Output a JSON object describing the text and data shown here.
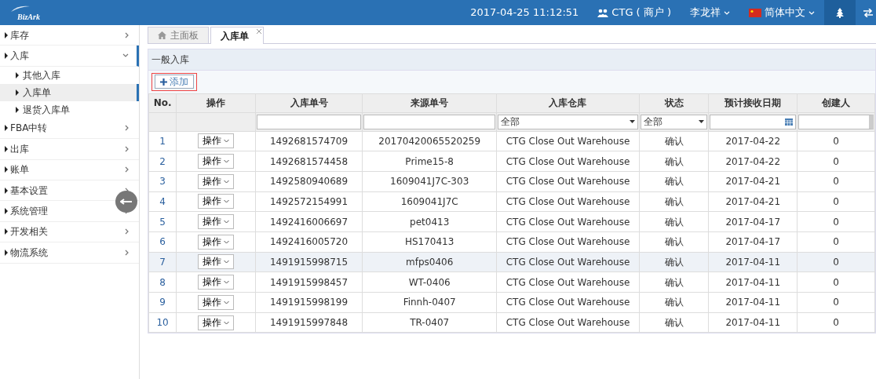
{
  "header": {
    "logo": "BizArk",
    "datetime": "2017-04-25 11:12:51",
    "merchant": "CTG ( 商户 )",
    "user": "李龙祥",
    "language": "简体中文"
  },
  "sidebar": {
    "items": [
      {
        "label": "库存",
        "expanded": false,
        "selected": false
      },
      {
        "label": "入库",
        "expanded": true,
        "selected": false,
        "children": [
          {
            "label": "其他入库",
            "selected": false
          },
          {
            "label": "入库单",
            "selected": true
          },
          {
            "label": "退货入库单",
            "selected": false
          }
        ]
      },
      {
        "label": "FBA中转",
        "expanded": false,
        "selected": false
      },
      {
        "label": "出库",
        "expanded": false,
        "selected": false
      },
      {
        "label": "账单",
        "expanded": false,
        "selected": false
      },
      {
        "label": "基本设置",
        "expanded": false,
        "selected": false
      },
      {
        "label": "系统管理",
        "expanded": false,
        "selected": false
      },
      {
        "label": "开发相关",
        "expanded": false,
        "selected": false
      },
      {
        "label": "物流系统",
        "expanded": false,
        "selected": false
      }
    ]
  },
  "tabs": [
    {
      "label": "主面板",
      "kind": "home",
      "selected": false
    },
    {
      "label": "入库单",
      "kind": "closable",
      "selected": true
    }
  ],
  "panel": {
    "title": "一般入库",
    "add_button": "添加"
  },
  "table": {
    "columns": [
      "No.",
      "操作",
      "入库单号",
      "来源单号",
      "入库仓库",
      "状态",
      "预计接收日期",
      "创建人"
    ],
    "filters": [
      {
        "kind": "none"
      },
      {
        "kind": "none"
      },
      {
        "kind": "text"
      },
      {
        "kind": "text"
      },
      {
        "kind": "select",
        "value": "全部"
      },
      {
        "kind": "select",
        "value": "全部"
      },
      {
        "kind": "date"
      },
      {
        "kind": "combo"
      }
    ],
    "rows": [
      {
        "no": "1",
        "action": "操作",
        "order": "1492681574709",
        "source": "20170420065520259",
        "warehouse": "CTG Close Out Warehouse",
        "status": "确认",
        "date": "2017-04-22",
        "creator": "0",
        "selected": false
      },
      {
        "no": "2",
        "action": "操作",
        "order": "1492681574458",
        "source": "Prime15-8",
        "warehouse": "CTG Close Out Warehouse",
        "status": "确认",
        "date": "2017-04-22",
        "creator": "0",
        "selected": false
      },
      {
        "no": "3",
        "action": "操作",
        "order": "1492580940689",
        "source": "1609041J7C-303",
        "warehouse": "CTG Close Out Warehouse",
        "status": "确认",
        "date": "2017-04-21",
        "creator": "0",
        "selected": false
      },
      {
        "no": "4",
        "action": "操作",
        "order": "1492572154991",
        "source": "1609041J7C",
        "warehouse": "CTG Close Out Warehouse",
        "status": "确认",
        "date": "2017-04-21",
        "creator": "0",
        "selected": false
      },
      {
        "no": "5",
        "action": "操作",
        "order": "1492416006697",
        "source": "pet0413",
        "warehouse": "CTG Close Out Warehouse",
        "status": "确认",
        "date": "2017-04-17",
        "creator": "0",
        "selected": false
      },
      {
        "no": "6",
        "action": "操作",
        "order": "1492416005720",
        "source": "HS170413",
        "warehouse": "CTG Close Out Warehouse",
        "status": "确认",
        "date": "2017-04-17",
        "creator": "0",
        "selected": false
      },
      {
        "no": "7",
        "action": "操作",
        "order": "1491915998715",
        "source": "mfps0406",
        "warehouse": "CTG Close Out Warehouse",
        "status": "确认",
        "date": "2017-04-11",
        "creator": "0",
        "selected": true
      },
      {
        "no": "8",
        "action": "操作",
        "order": "1491915998457",
        "source": "WT-0406",
        "warehouse": "CTG Close Out Warehouse",
        "status": "确认",
        "date": "2017-04-11",
        "creator": "0",
        "selected": false
      },
      {
        "no": "9",
        "action": "操作",
        "order": "1491915998199",
        "source": "Finnh-0407",
        "warehouse": "CTG Close Out Warehouse",
        "status": "确认",
        "date": "2017-04-11",
        "creator": "0",
        "selected": false
      },
      {
        "no": "10",
        "action": "操作",
        "order": "1491915997848",
        "source": "TR-0407",
        "warehouse": "CTG Close Out Warehouse",
        "status": "确认",
        "date": "2017-04-11",
        "creator": "0",
        "selected": false
      }
    ]
  }
}
